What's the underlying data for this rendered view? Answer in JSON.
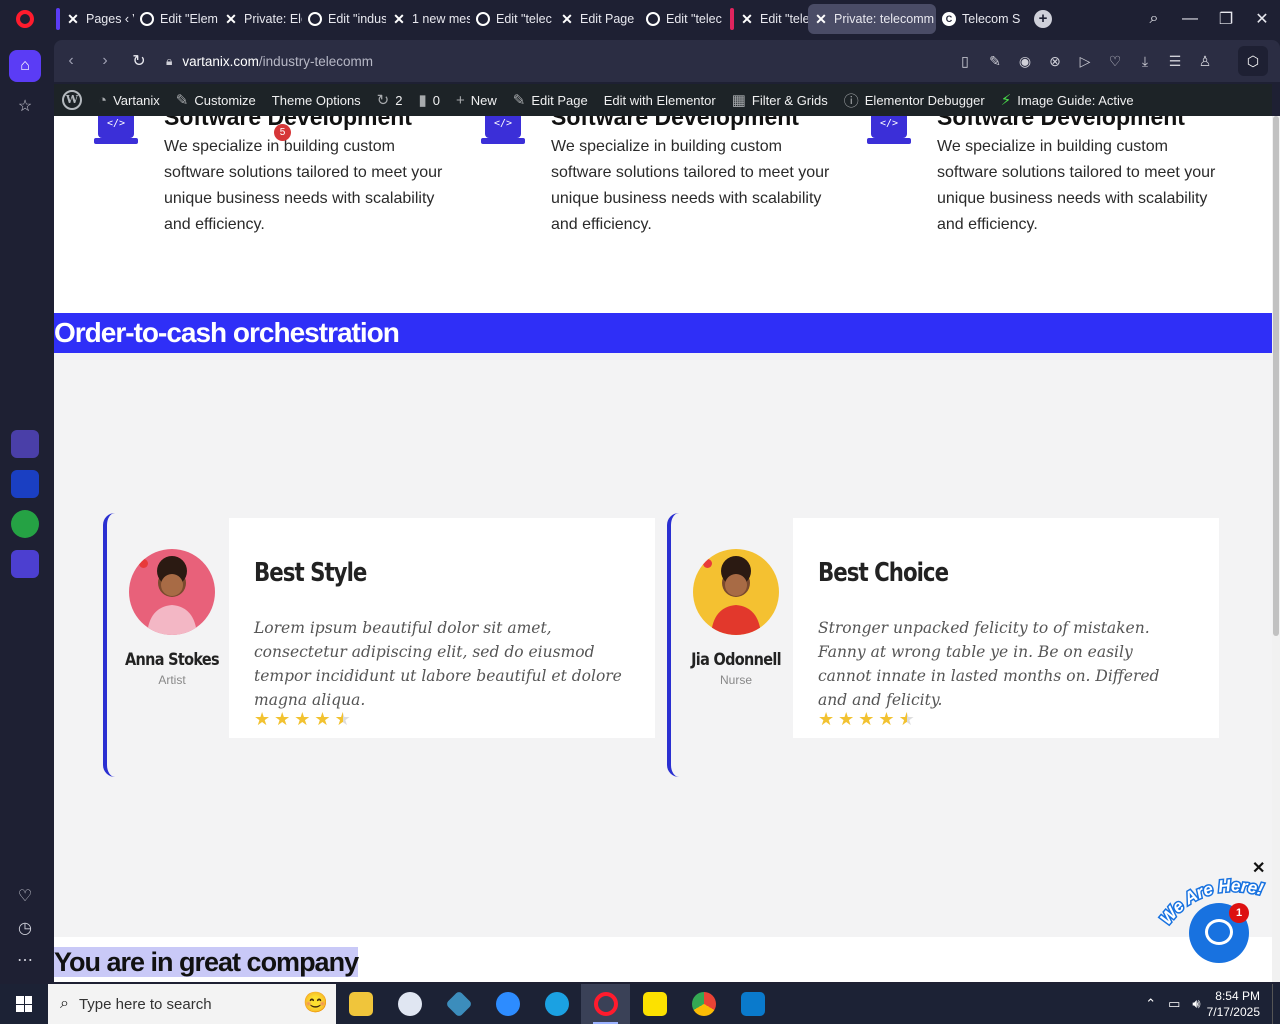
{
  "browser": {
    "tabs": [
      {
        "title": "Pages ‹ Va",
        "favicon": "x-icon",
        "group": "#5b3cf5"
      },
      {
        "title": "Edit \"Elem",
        "favicon": "globe-icon"
      },
      {
        "title": "Private: Ele",
        "favicon": "x-icon"
      },
      {
        "title": "Edit \"indus",
        "favicon": "globe-icon"
      },
      {
        "title": "1 new mes",
        "favicon": "x-icon"
      },
      {
        "title": "Edit \"telec",
        "favicon": "globe-icon"
      },
      {
        "title": "Edit Page",
        "favicon": "x-icon"
      },
      {
        "title": "Edit \"telec",
        "favicon": "globe-icon"
      },
      {
        "title": "Edit \"telec",
        "favicon": "x-icon",
        "group": "#e0245e"
      },
      {
        "title": "Private: telecomm",
        "favicon": "x-icon",
        "active": true
      },
      {
        "title": "Telecom S",
        "favicon": "telecom-icon"
      }
    ],
    "url_domain": "vartanix.com",
    "url_path": "/industry-telecomm"
  },
  "wpbar": {
    "site": "Vartanix",
    "customize": "Customize",
    "theme_options": "Theme Options",
    "updates": "2",
    "comments": "0",
    "new": "New",
    "edit_page": "Edit Page",
    "edit_elementor": "Edit with Elementor",
    "filter_grids": "Filter & Grids",
    "debugger": "Elementor Debugger",
    "image_guide": "Image Guide: Active"
  },
  "ghost_header": {
    "badge": "5"
  },
  "services": [
    {
      "title": "Software Development",
      "text": "We specialize in building custom software solutions tailored to meet your unique business needs with scalability and efficiency."
    },
    {
      "title": "Software Development",
      "text": "We specialize in building custom software solutions tailored to meet your unique business needs with scalability and efficiency."
    },
    {
      "title": "Software Development",
      "text": "We specialize in building custom software solutions tailored to meet your unique business needs with scalability and efficiency."
    }
  ],
  "band_title": "Order-to-cash orchestration",
  "testimonials": [
    {
      "name": "Anna Stokes",
      "role": "Artist",
      "heading": "Best Style",
      "quote": "Lorem ipsum beautiful dolor sit amet, consectetur adipiscing elit, sed do eiusmod tempor incididunt ut labore beautiful et dolore magna aliqua.",
      "rating": 4.5,
      "avatar_bg": "#e8617a"
    },
    {
      "name": "Jia Odonnell",
      "role": "Nurse",
      "heading": "Best Choice",
      "quote": "Stronger unpacked felicity to of mistaken. Fanny at wrong table ye in. Be on easily cannot innate in lasted months on. Differed and and felicity.",
      "rating": 4.5,
      "avatar_bg": "#f4c131"
    }
  ],
  "bottom_title": "You are in great company",
  "chat": {
    "tagline": "We Are Here!",
    "badge": "1"
  },
  "taskbar": {
    "search_placeholder": "Type here to search",
    "time": "8:54 PM",
    "date": "7/17/2025"
  },
  "colors": {
    "accent": "#2f2ff7",
    "card_border": "#2a2fd1",
    "star": "#f2c230"
  }
}
